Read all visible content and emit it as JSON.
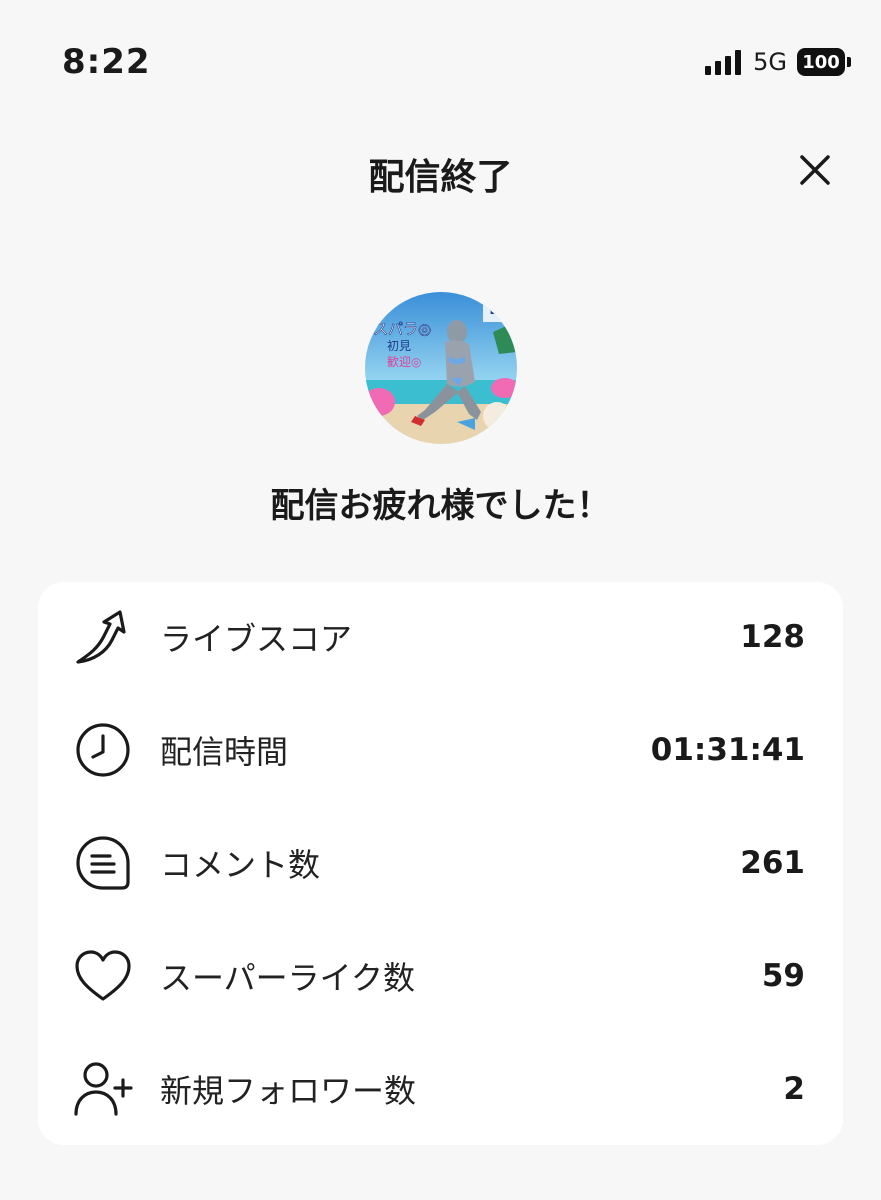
{
  "status_bar": {
    "time": "8:22",
    "network": "5G",
    "battery": "100"
  },
  "header": {
    "title": "配信終了"
  },
  "message": "配信お疲れ様でした！",
  "avatar_overlay": {
    "line1": "スパラ◎",
    "line2": "初見",
    "line3": "歓迎◎",
    "corner": "B"
  },
  "stats": [
    {
      "icon": "rising-arrow-icon",
      "label": "ライブスコア",
      "value": "128"
    },
    {
      "icon": "clock-icon",
      "label": "配信時間",
      "value": "01:31:41"
    },
    {
      "icon": "comment-icon",
      "label": "コメント数",
      "value": "261"
    },
    {
      "icon": "heart-icon",
      "label": "スーパーライク数",
      "value": "59"
    },
    {
      "icon": "add-user-icon",
      "label": "新規フォロワー数",
      "value": "2"
    }
  ]
}
